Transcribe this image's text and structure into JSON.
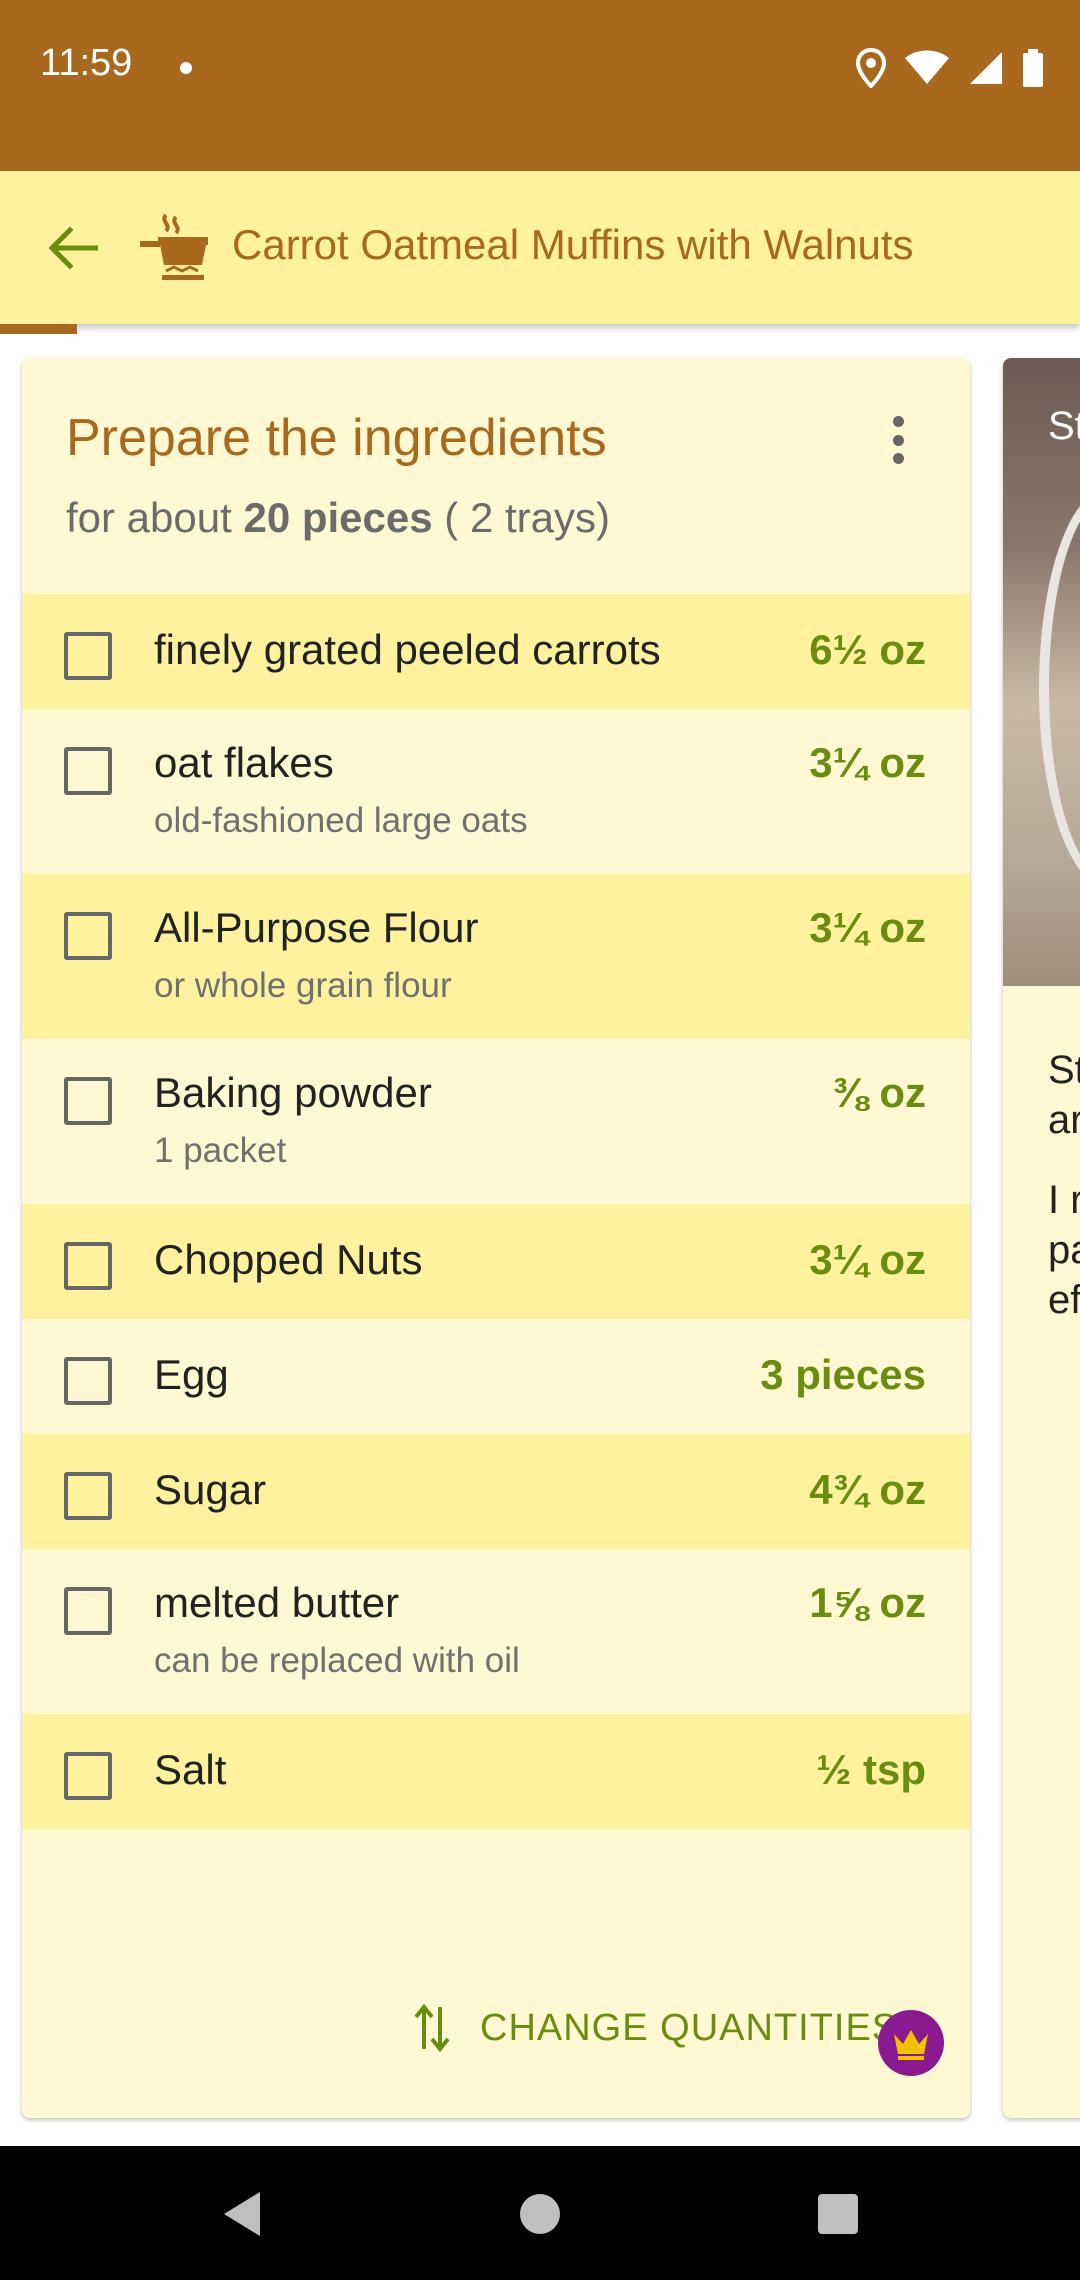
{
  "status_bar": {
    "time": "11:59",
    "icons": [
      "notification-dot",
      "location-icon",
      "wifi-icon",
      "signal-icon",
      "battery-icon"
    ]
  },
  "app_bar": {
    "title": "Carrot Oatmeal Muffins with Walnuts",
    "back_icon": "arrow-left-icon",
    "logo_icon": "cooking-pot-icon"
  },
  "ingredients_card": {
    "title": "Prepare the ingredients",
    "subtitle_prefix": "for about ",
    "subtitle_amount": "20 pieces",
    "subtitle_suffix": " ( 2 trays)",
    "items": [
      {
        "name": "finely grated peeled carrots",
        "note": "",
        "qty": "6½ oz",
        "checked": false
      },
      {
        "name": "oat flakes",
        "note": "old-fashioned large oats",
        "qty": "3¼ oz",
        "checked": false
      },
      {
        "name": "All-Purpose Flour",
        "note": "or whole grain flour",
        "qty": "3¼ oz",
        "checked": false
      },
      {
        "name": "Baking powder",
        "note": "1 packet",
        "qty": "⅜ oz",
        "checked": false
      },
      {
        "name": "Chopped Nuts",
        "note": "",
        "qty": "3¼ oz",
        "checked": false
      },
      {
        "name": "Egg",
        "note": "",
        "qty": "3 pieces",
        "checked": false
      },
      {
        "name": "Sugar",
        "note": "",
        "qty": "4¾ oz",
        "checked": false
      },
      {
        "name": "melted butter",
        "note": "can be replaced with oil",
        "qty": "1⅝ oz",
        "checked": false
      },
      {
        "name": "Salt",
        "note": "",
        "qty": "½ tsp",
        "checked": false
      }
    ],
    "change_quantities_label": "CHANGE QUANTITIES",
    "premium_icon": "crown-icon"
  },
  "next_card": {
    "title_fragment": "St",
    "text_lines": [
      "St",
      "ar",
      "I r",
      "pa",
      "ef"
    ]
  },
  "colors": {
    "status_bar": "#a8691e",
    "app_bar": "#fff29e",
    "card_bg": "#fff9d3",
    "title_brown": "#a8691e",
    "quantity_green": "#6a8d10",
    "premium_purple": "#8b1a91"
  }
}
